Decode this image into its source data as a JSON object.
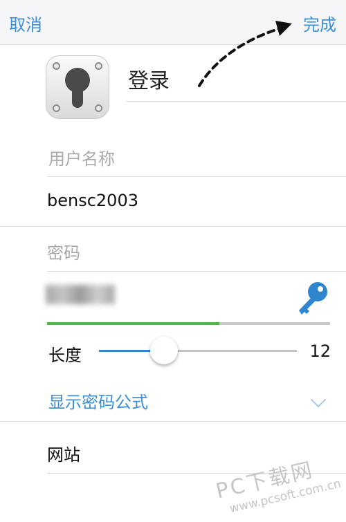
{
  "navbar": {
    "cancel_label": "取消",
    "done_label": "完成"
  },
  "header": {
    "title": "登录",
    "icon": "keyhole-lock-icon"
  },
  "username": {
    "label": "用户名称",
    "value": "bensc2003"
  },
  "password": {
    "label": "密码",
    "value_obscured": true,
    "strength_fraction": 0.61,
    "strength_color": "#4cb848",
    "generate_icon": "key-icon",
    "key_icon_color": "#2f86cf"
  },
  "length": {
    "label": "长度",
    "value": "12",
    "slider_fraction": 0.33
  },
  "formula": {
    "label": "显示密码公式",
    "icon": "chevron-down-icon"
  },
  "website": {
    "label": "网站"
  },
  "watermark": {
    "text": "PC下载网",
    "url": "www.pcsoft.com.cn"
  },
  "colors": {
    "accent": "#3b8fd6",
    "navbar_bg": "#f6f6f8"
  }
}
